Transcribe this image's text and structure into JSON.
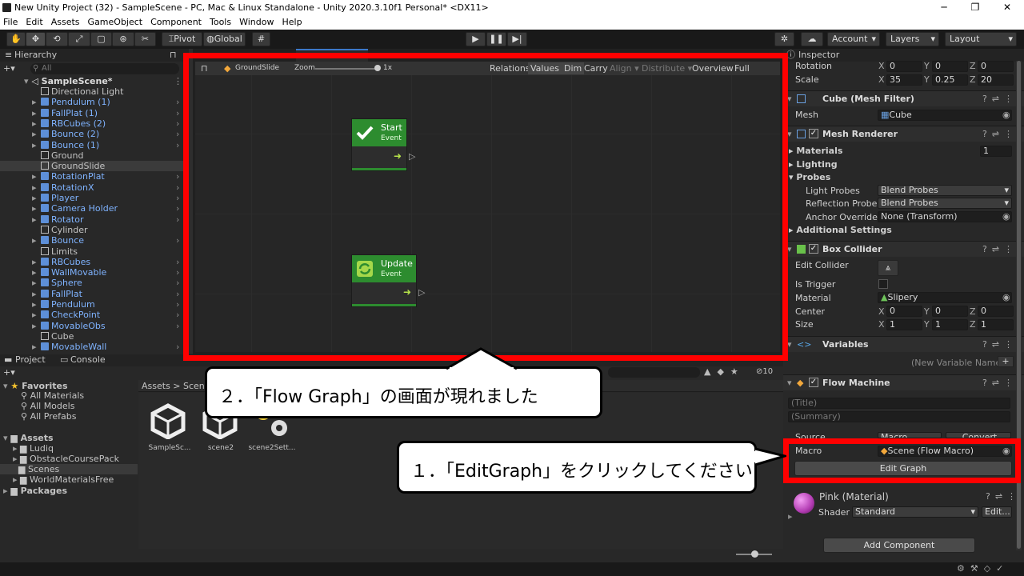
{
  "window": {
    "title": "New Unity Project (32) - SampleScene - PC, Mac & Linux Standalone - Unity 2020.3.10f1 Personal* <DX11>"
  },
  "menu": [
    "File",
    "Edit",
    "Assets",
    "GameObject",
    "Component",
    "Tools",
    "Window",
    "Help"
  ],
  "toolbar": {
    "pivot": "Pivot",
    "global": "Global",
    "account": "Account",
    "layers": "Layers",
    "layout": "Layout"
  },
  "hierarchy": {
    "title": "Hierarchy",
    "search_placeholder": "All",
    "scene": "SampleScene*",
    "items": [
      {
        "name": "Directional Light",
        "prefab": false
      },
      {
        "name": "Pendulum (1)",
        "prefab": true
      },
      {
        "name": "FallPlat (1)",
        "prefab": true
      },
      {
        "name": "RBCubes (2)",
        "prefab": true
      },
      {
        "name": "Bounce (2)",
        "prefab": true
      },
      {
        "name": "Bounce (1)",
        "prefab": true
      },
      {
        "name": "Ground",
        "prefab": false
      },
      {
        "name": "GroundSlide",
        "prefab": false,
        "selected": true
      },
      {
        "name": "RotationPlat",
        "prefab": true
      },
      {
        "name": "RotationX",
        "prefab": true
      },
      {
        "name": "Player",
        "prefab": true
      },
      {
        "name": "Camera Holder",
        "prefab": true
      },
      {
        "name": "Rotator",
        "prefab": true
      },
      {
        "name": "Cylinder",
        "prefab": false
      },
      {
        "name": "Bounce",
        "prefab": true
      },
      {
        "name": "Limits",
        "prefab": false
      },
      {
        "name": "RBCubes",
        "prefab": true
      },
      {
        "name": "WallMovable",
        "prefab": true
      },
      {
        "name": "Sphere",
        "prefab": true
      },
      {
        "name": "FallPlat",
        "prefab": true
      },
      {
        "name": "Pendulum",
        "prefab": true
      },
      {
        "name": "CheckPoint",
        "prefab": true
      },
      {
        "name": "MovableObs",
        "prefab": true
      },
      {
        "name": "Cube",
        "prefab": false
      },
      {
        "name": "MovableWall",
        "prefab": true
      }
    ]
  },
  "graph": {
    "breadcrumb": "GroundSlide",
    "zoom_label": "Zoom",
    "zoom_value": "1x",
    "tools": [
      "Relations",
      "Values",
      "Dim",
      "Carry",
      "Align ▾",
      "Distribute ▾",
      "Overview",
      "Full Screen"
    ],
    "nodes": [
      {
        "title": "Start",
        "sub": "Event"
      },
      {
        "title": "Update",
        "sub": "Event"
      }
    ]
  },
  "project": {
    "tabs": [
      "Project",
      "Console"
    ],
    "favorites_title": "Favorites",
    "favorites": [
      "All Materials",
      "All Models",
      "All Prefabs"
    ],
    "assets_title": "Assets",
    "assets": [
      "Ludiq",
      "ObstacleCoursePack",
      "Scenes",
      "WorldMaterialsFree"
    ],
    "packages": "Packages",
    "breadcrumb": "Assets > Scenes",
    "files": [
      "SampleSc...",
      "scene2",
      "scene2Sett..."
    ],
    "count": "10"
  },
  "inspector": {
    "title": "Inspector",
    "rotation": {
      "label": "Rotation",
      "x": "0",
      "y": "0",
      "z": "0"
    },
    "scale": {
      "label": "Scale",
      "x": "35",
      "y": "0.25",
      "z": "20"
    },
    "mesh_filter": {
      "title": "Cube (Mesh Filter)",
      "mesh_label": "Mesh",
      "mesh_value": "Cube"
    },
    "mesh_renderer": {
      "title": "Mesh Renderer",
      "materials": "Materials",
      "materials_count": "1",
      "lighting": "Lighting",
      "probes": "Probes",
      "light_probes": "Light Probes",
      "light_probes_value": "Blend Probes",
      "reflection_probes": "Reflection Probes",
      "reflection_value": "Blend Probes",
      "anchor": "Anchor Override",
      "anchor_value": "None (Transform)",
      "additional": "Additional Settings"
    },
    "box_collider": {
      "title": "Box Collider",
      "edit_collider": "Edit Collider",
      "is_trigger": "Is Trigger",
      "material": "Material",
      "material_value": "Slipery",
      "center": "Center",
      "cx": "0",
      "cy": "0",
      "cz": "0",
      "size": "Size",
      "sx": "1",
      "sy": "1",
      "sz": "1"
    },
    "variables": {
      "title": "Variables",
      "new_placeholder": "(New Variable Name)"
    },
    "flow_machine": {
      "title": "Flow Machine",
      "title_placeholder": "(Title)",
      "summary_placeholder": "(Summary)",
      "source": "Source",
      "source_value": "Macro",
      "convert": "Convert",
      "macro": "Macro",
      "macro_value": "Scene (Flow Macro)",
      "edit_graph": "Edit Graph"
    },
    "material": {
      "title": "Pink (Material)",
      "shader_label": "Shader",
      "shader_value": "Standard",
      "edit": "Edit..."
    },
    "add_component": "Add Component"
  },
  "callouts": {
    "step2": "２．「Flow Graph」の画面が現れました",
    "step1": "１．「EditGraph」をクリックしてください"
  },
  "colors": {
    "highlight": "#ff0000",
    "node_green": "#2d8c2f",
    "selection": "#2c5d87"
  }
}
